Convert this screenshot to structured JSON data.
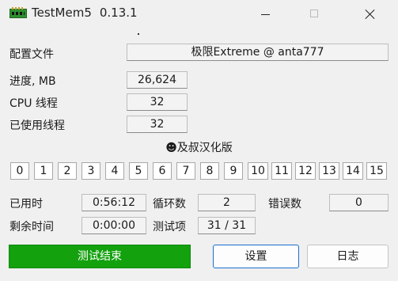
{
  "window": {
    "title": "TestMem5",
    "version": "0.13.1"
  },
  "config": {
    "label": "配置文件",
    "value": "极限Extreme @ anta777"
  },
  "progress": {
    "label": "进度, MB",
    "value": "26,624"
  },
  "cpu_threads": {
    "label": "CPU 线程",
    "value": "32"
  },
  "used_threads": {
    "label": "已使用线程",
    "value": "32"
  },
  "credit": "☻及叔汉化版",
  "threads": [
    "0",
    "1",
    "2",
    "3",
    "4",
    "5",
    "6",
    "7",
    "8",
    "9",
    "10",
    "11",
    "12",
    "13",
    "14",
    "15"
  ],
  "stats": {
    "elapsed_label": "已用时",
    "elapsed_value": "0:56:12",
    "cycles_label": "循环数",
    "cycles_value": "2",
    "errors_label": "错误数",
    "errors_value": "0",
    "remaining_label": "剩余时间",
    "remaining_value": "0:00:00",
    "tests_label": "测试项",
    "tests_value": "31 / 31"
  },
  "buttons": {
    "exit_label": "测试结束",
    "settings_label": "设置",
    "log_label": "日志"
  },
  "colors": {
    "exit_button": "#13a10e",
    "settings_border": "#1a6fd1"
  }
}
